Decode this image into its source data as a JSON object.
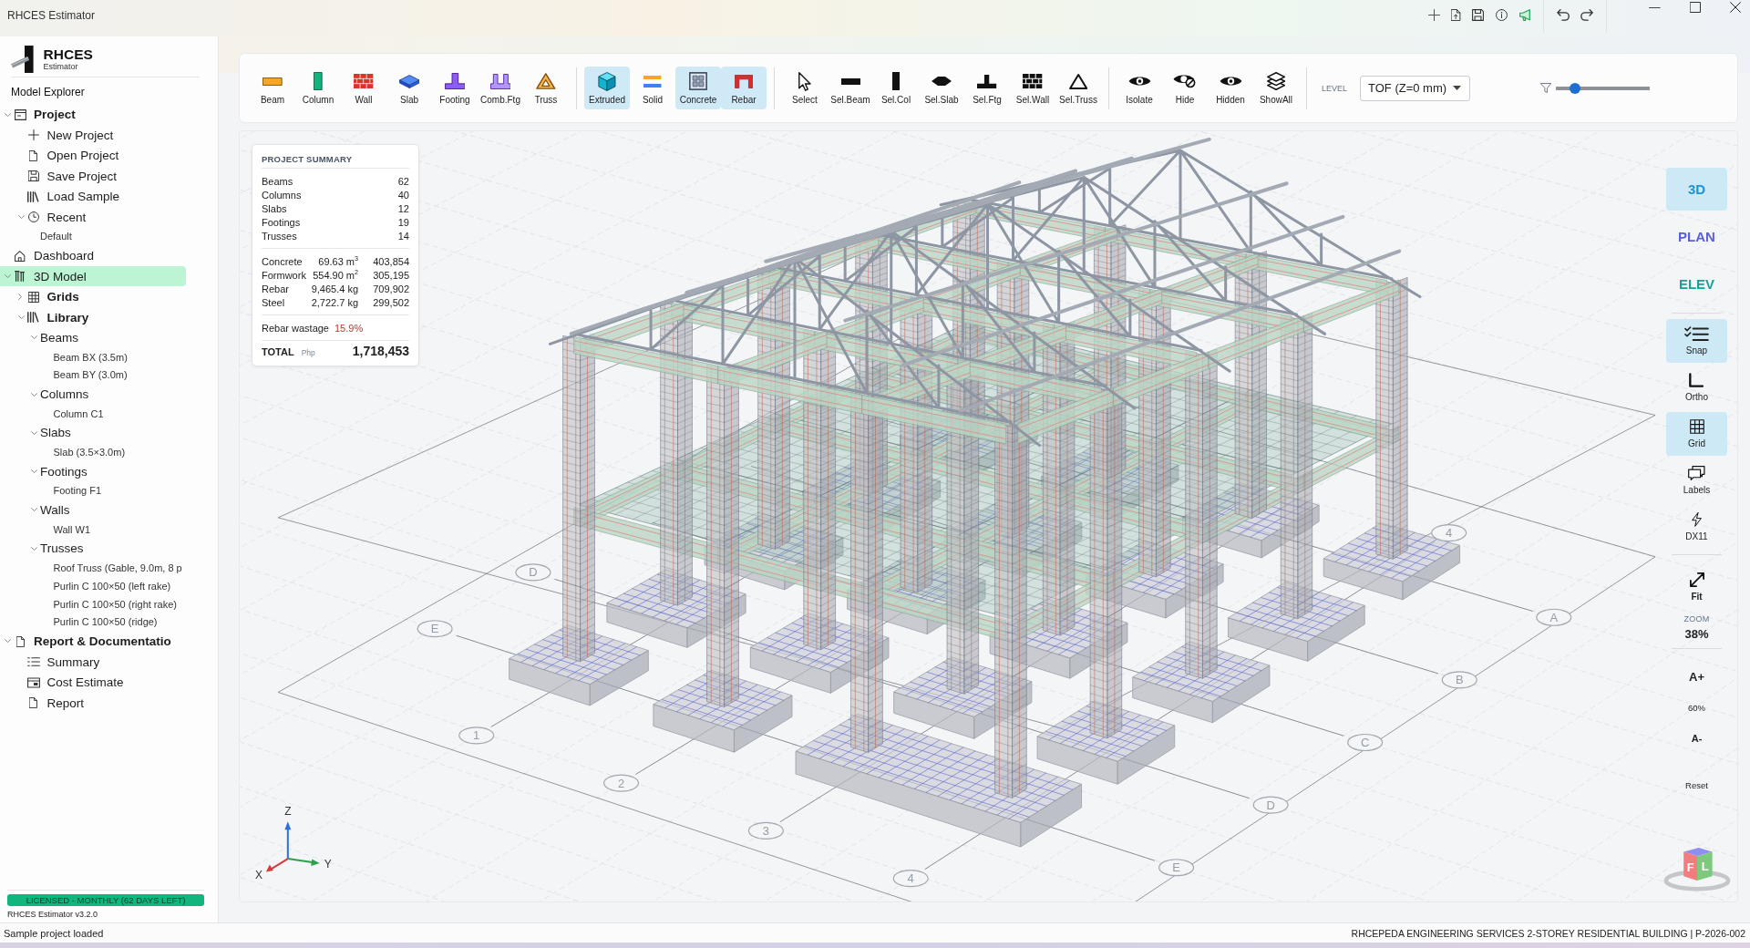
{
  "window": {
    "title": "RHCES Estimator"
  },
  "sidebar": {
    "brand": {
      "name": "RHCES",
      "subtitle": "Estimator"
    },
    "heading": "Model Explorer",
    "tree": [
      {
        "label": "Project",
        "kind": "section",
        "expanded": true,
        "selected": false,
        "children": [
          {
            "label": "New Project",
            "kind": "item",
            "selected": false
          },
          {
            "label": "Open Project",
            "kind": "item",
            "selected": false
          },
          {
            "label": "Save Project",
            "kind": "item",
            "selected": false
          },
          {
            "label": "Load Sample",
            "kind": "item",
            "selected": false
          },
          {
            "label": "Recent",
            "kind": "item",
            "expanded": true,
            "selected": false,
            "children": [
              {
                "label": "Default",
                "kind": "entry",
                "selected": false
              }
            ]
          }
        ]
      },
      {
        "label": "Dashboard",
        "kind": "item",
        "selected": false
      },
      {
        "label": "3D Model",
        "kind": "item",
        "expanded": true,
        "selected": true,
        "children": [
          {
            "label": "Grids",
            "kind": "section",
            "expanded": false,
            "selected": false
          },
          {
            "label": "Library",
            "kind": "section",
            "expanded": true,
            "selected": false,
            "children": [
              {
                "label": "Beams",
                "kind": "item",
                "expanded": true,
                "selected": false,
                "children": [
                  {
                    "label": "Beam BX (3.5m)",
                    "kind": "entry",
                    "selected": false
                  },
                  {
                    "label": "Beam BY (3.0m)",
                    "kind": "entry",
                    "selected": false
                  }
                ]
              },
              {
                "label": "Columns",
                "kind": "item",
                "expanded": true,
                "selected": false,
                "children": [
                  {
                    "label": "Column C1",
                    "kind": "entry",
                    "selected": false
                  }
                ]
              },
              {
                "label": "Slabs",
                "kind": "item",
                "expanded": true,
                "selected": false,
                "children": [
                  {
                    "label": "Slab (3.5×3.0m)",
                    "kind": "entry",
                    "selected": false
                  }
                ]
              },
              {
                "label": "Footings",
                "kind": "item",
                "expanded": true,
                "selected": false,
                "children": [
                  {
                    "label": "Footing F1",
                    "kind": "entry",
                    "selected": false
                  }
                ]
              },
              {
                "label": "Walls",
                "kind": "item",
                "expanded": true,
                "selected": false,
                "children": [
                  {
                    "label": "Wall W1",
                    "kind": "entry",
                    "selected": false
                  }
                ]
              },
              {
                "label": "Trusses",
                "kind": "item",
                "expanded": true,
                "selected": false,
                "children": [
                  {
                    "label": "Roof Truss (Gable, 9.0m, 8 p",
                    "kind": "entry",
                    "selected": false
                  },
                  {
                    "label": "Purlin C 100×50 (left rake)",
                    "kind": "entry",
                    "selected": false
                  },
                  {
                    "label": "Purlin C 100×50 (right rake)",
                    "kind": "entry",
                    "selected": false
                  },
                  {
                    "label": "Purlin C 100×50 (ridge)",
                    "kind": "entry",
                    "selected": false
                  }
                ]
              }
            ]
          }
        ]
      },
      {
        "label": "Report & Documentatio",
        "kind": "section",
        "expanded": true,
        "selected": false,
        "children": [
          {
            "label": "Summary",
            "kind": "item",
            "selected": false
          },
          {
            "label": "Cost Estimate",
            "kind": "item",
            "selected": false
          },
          {
            "label": "Report",
            "kind": "item",
            "selected": false
          }
        ]
      }
    ],
    "license": "LICENSED - MONTHLY (62 DAYS LEFT)",
    "version": "RHCES Estimator v3.2.0"
  },
  "toolbar": {
    "groups": [
      {
        "items": [
          {
            "label": "Beam",
            "on": false
          },
          {
            "label": "Column",
            "on": false
          },
          {
            "label": "Wall",
            "on": false
          },
          {
            "label": "Slab",
            "on": false
          },
          {
            "label": "Footing",
            "on": false
          },
          {
            "label": "Comb.Ftg",
            "on": false
          },
          {
            "label": "Truss",
            "on": false
          }
        ]
      },
      {
        "items": [
          {
            "label": "Extruded",
            "on": true
          },
          {
            "label": "Solid",
            "on": false
          },
          {
            "label": "Concrete",
            "on": true
          },
          {
            "label": "Rebar",
            "on": true
          }
        ]
      },
      {
        "items": [
          {
            "label": "Select",
            "on": false
          },
          {
            "label": "Sel.Beam",
            "on": false
          },
          {
            "label": "Sel.Col",
            "on": false
          },
          {
            "label": "Sel.Slab",
            "on": false
          },
          {
            "label": "Sel.Ftg",
            "on": false
          },
          {
            "label": "Sel.Wall",
            "on": false
          },
          {
            "label": "Sel.Truss",
            "on": false
          }
        ]
      },
      {
        "items": [
          {
            "label": "Isolate",
            "on": false
          },
          {
            "label": "Hide",
            "on": false
          },
          {
            "label": "Hidden",
            "on": false
          },
          {
            "label": "ShowAll",
            "on": false
          }
        ]
      }
    ],
    "level_select": {
      "label": "LEVEL",
      "value": "TOF (Z=0 mm)"
    },
    "filter_slider": {
      "level": 0.2
    }
  },
  "viewport": {
    "summary": {
      "title": "PROJECT SUMMARY",
      "counts": [
        {
          "label": "Beams",
          "value": "62"
        },
        {
          "label": "Columns",
          "value": "40"
        },
        {
          "label": "Slabs",
          "value": "12"
        },
        {
          "label": "Footings",
          "value": "19"
        },
        {
          "label": "Trusses",
          "value": "14"
        }
      ],
      "costs": [
        {
          "label": "Concrete",
          "quantity": "69.63 m$^{3}$",
          "amount": "403,854"
        },
        {
          "label": "Formwork",
          "quantity": "554.90 m$^{2}$",
          "amount": "305,195"
        },
        {
          "label": "Rebar",
          "quantity": "9,465.4 kg",
          "amount": "709,902"
        },
        {
          "label": "Steel",
          "quantity": "2,722.7 kg",
          "amount": "299,502"
        }
      ],
      "wastage": {
        "label": "Rebar wastage",
        "value": "15.9%"
      },
      "total": {
        "label": "TOTAL",
        "currency": "Php",
        "value": "1,718,453"
      }
    },
    "model": {
      "front_axis_labels": [
        "1",
        "2",
        "3",
        "4"
      ],
      "back_axis_labels": [
        "4"
      ],
      "right_axis_labels": [
        "A",
        "B",
        "C",
        "D",
        "E"
      ],
      "left_axis_labels": [
        "D",
        "E"
      ],
      "axes": [
        {
          "label": "Z"
        },
        {
          "label": "X"
        },
        {
          "label": "Y"
        }
      ]
    },
    "view_panel": {
      "modes": [
        {
          "label": "3D",
          "selected": true
        },
        {
          "label": "PLAN",
          "selected": false
        },
        {
          "label": "ELEV",
          "selected": false
        }
      ],
      "toggles": [
        {
          "label": "Snap",
          "on": true
        },
        {
          "label": "Ortho",
          "on": false
        },
        {
          "label": "Grid",
          "on": true
        },
        {
          "label": "Labels",
          "on": false
        },
        {
          "label": "DX11",
          "on": false
        }
      ],
      "fit": "Fit",
      "zoom": {
        "label": "ZOOM",
        "value": "38%"
      },
      "text_size": {
        "increase": "A+",
        "value": "60%",
        "decrease": "A-"
      },
      "reset": "Reset",
      "view_cube": [
        "F",
        "L"
      ]
    }
  },
  "status_bar": {
    "message": "Sample project loaded",
    "project": "RHCEPEDA ENGINEERING SERVICES 2-STOREY RESIDENTIAL BUILDING | P-2026-002"
  }
}
